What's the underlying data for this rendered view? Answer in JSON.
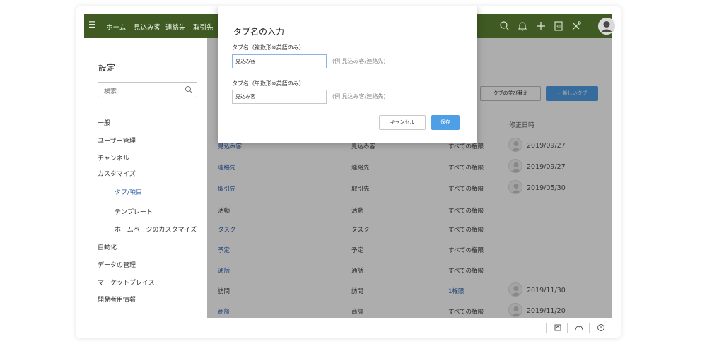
{
  "nav": {
    "menu_icon": "hamburger-icon",
    "items": [
      "ホーム",
      "見込み客",
      "連絡先",
      "取引先"
    ],
    "icons": [
      "search-icon",
      "bell-icon",
      "plus-icon",
      "calendar-icon",
      "tools-icon",
      "avatar-icon"
    ]
  },
  "sidebar": {
    "title": "設定",
    "search_placeholder": "検索",
    "items": [
      "一般",
      "ユーザー管理",
      "チャンネル",
      "カスタマイズ",
      "タブ/項目",
      "テンプレート",
      "ホームページのカスタマイズ",
      "自動化",
      "データの管理",
      "マーケットプレイス",
      "開発者用情報"
    ]
  },
  "main": {
    "sort_button": "タブの並び替え",
    "new_button": "+ 新しいタブ",
    "column_modified": "修正日時",
    "rows": [
      {
        "name": "見込み客",
        "label": "見込み客",
        "perm": "すべての権限",
        "date": "2019/09/27"
      },
      {
        "name": "連絡先",
        "label": "連絡先",
        "perm": "すべての権限",
        "date": "2019/09/27"
      },
      {
        "name": "取引先",
        "label": "取引先",
        "perm": "すべての権限",
        "date": "2019/05/30"
      },
      {
        "name": "活動",
        "label": "活動",
        "perm": "すべての権限",
        "date": ""
      },
      {
        "name": "タスク",
        "label": "タスク",
        "perm": "すべての権限",
        "date": ""
      },
      {
        "name": "予定",
        "label": "予定",
        "perm": "すべての権限",
        "date": ""
      },
      {
        "name": "通話",
        "label": "通話",
        "perm": "すべての権限",
        "date": ""
      },
      {
        "name": "訪問",
        "label": "訪問",
        "perm": "1権限",
        "date": "2019/11/30"
      },
      {
        "name": "商談",
        "label": "商談",
        "perm": "すべての権限",
        "date": "2019/11/20"
      }
    ]
  },
  "modal": {
    "title": "タブ名の入力",
    "plural_label": "タブ名（複数形※英語のみ）",
    "plural_value": "見込み客",
    "plural_hint": "(例 見込み客/連絡先)",
    "singular_label": "タブ名（単数形※英語のみ）",
    "singular_value": "見込み客",
    "singular_hint": "(例 見込み客/連絡先)",
    "cancel": "キャンセル",
    "save": "保存"
  },
  "colors": {
    "nav_bg": "#3f5a23",
    "accent": "#4f9fe7",
    "link": "#2e62b0"
  }
}
